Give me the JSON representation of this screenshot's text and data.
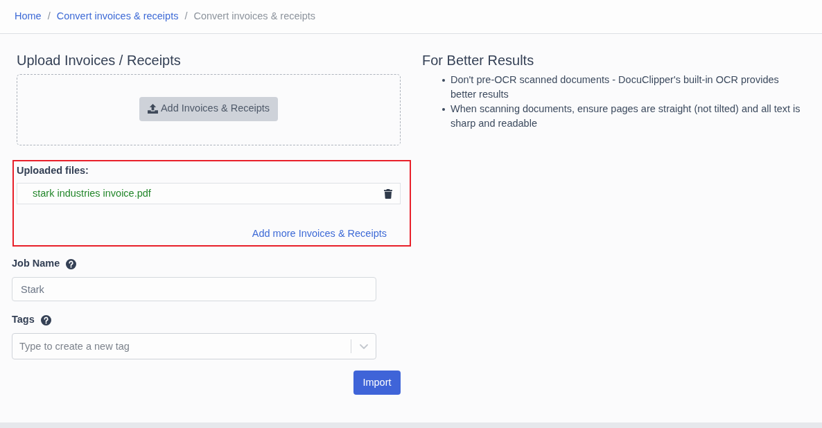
{
  "breadcrumb": [
    {
      "label": "Home",
      "kind": "link"
    },
    {
      "separator": "/",
      "label": "Convert invoices & receipts",
      "kind": "link"
    },
    {
      "separator": "/",
      "label": "Convert invoices & receipts",
      "kind": "current"
    }
  ],
  "upload": {
    "title": "Upload Invoices / Receipts",
    "button": "Add Invoices & Receipts"
  },
  "uploaded_files": {
    "highlighted": true,
    "label": "Uploaded files:",
    "files": [
      {
        "name": "stark industries invoice.pdf"
      }
    ],
    "add_more_link": "Add more Invoices & Receipts"
  },
  "job_name": {
    "label": "Job Name",
    "value": "Stark"
  },
  "tags": {
    "label": "Tags",
    "placeholder": "Type to create a new tag"
  },
  "import_button": "Import",
  "tips": {
    "title": "For Better Results",
    "items": [
      "Don't pre-OCR scanned documents - DocuClipper's built-in OCR provides better results",
      "When scanning documents, ensure pages are straight (not tilted) and all text is sharp and readable"
    ]
  }
}
